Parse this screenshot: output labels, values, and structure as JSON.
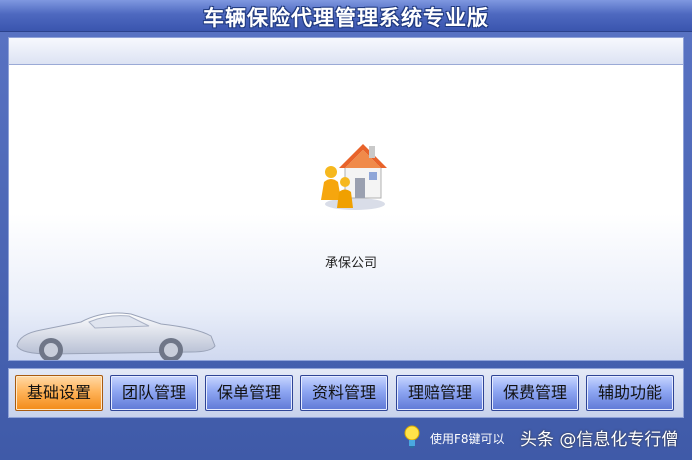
{
  "window": {
    "title": "车辆保险代理管理系统专业版"
  },
  "main": {
    "module": {
      "label": "承保公司",
      "icon": "house-people-icon"
    }
  },
  "nav": {
    "buttons": [
      {
        "label": "基础设置",
        "active": true
      },
      {
        "label": "团队管理"
      },
      {
        "label": "保单管理"
      },
      {
        "label": "资料管理"
      },
      {
        "label": "理赔管理"
      },
      {
        "label": "保费管理"
      },
      {
        "label": "辅助功能"
      }
    ]
  },
  "status": {
    "tip_text": "使用F8键可以",
    "tip_icon": "lightbulb-icon",
    "watermark": "头条 @信息化专行僧"
  },
  "colors": {
    "title_bar": "#4e69c0",
    "nav_button": "#8ea6f2",
    "nav_button_active": "#ffb45b"
  }
}
